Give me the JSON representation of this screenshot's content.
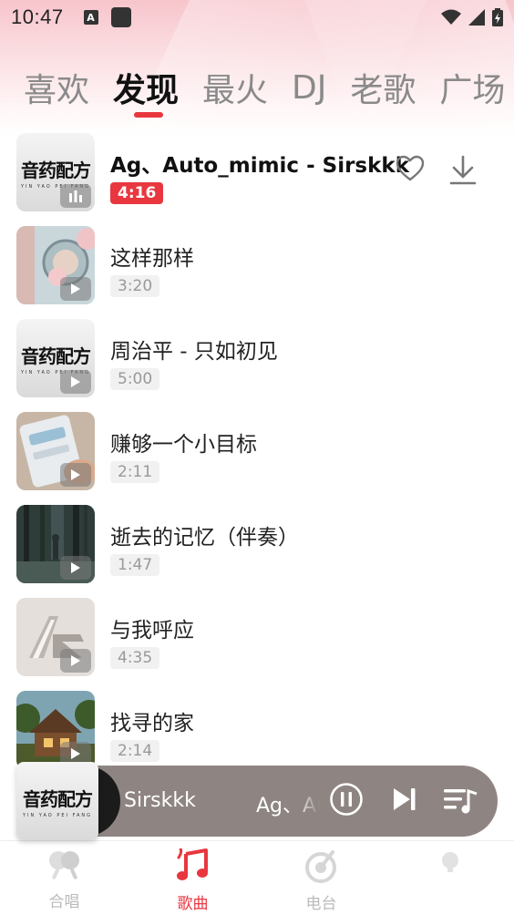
{
  "status": {
    "time": "10:47",
    "a_badge": "A"
  },
  "tabs": [
    "喜欢",
    "发现",
    "最火",
    "DJ",
    "老歌",
    "广场"
  ],
  "active_tab": "发现",
  "songs": [
    {
      "title": "Ag、Auto_mimic - Sirskkk",
      "duration": "4:16",
      "playing": true,
      "cover": "logo"
    },
    {
      "title": "这样那样",
      "duration": "3:20",
      "playing": false,
      "cover": "photo-pink"
    },
    {
      "title": "周治平 - 只如初见",
      "duration": "5:00",
      "playing": false,
      "cover": "logo"
    },
    {
      "title": "赚够一个小目标",
      "duration": "2:11",
      "playing": false,
      "cover": "photo-phone"
    },
    {
      "title": "逝去的记忆（伴奏）",
      "duration": "1:47",
      "playing": false,
      "cover": "photo-forest"
    },
    {
      "title": "与我呼应",
      "duration": "4:35",
      "playing": false,
      "cover": "photo-letters"
    },
    {
      "title": "找寻的家",
      "duration": "2:14",
      "playing": false,
      "cover": "photo-cabin"
    }
  ],
  "cover_logo": {
    "text": "音药配方",
    "sub": "YIN YAO PEI FANG"
  },
  "mini_player": {
    "title_part1": "Sirskkk",
    "title_part2": "Ag、Auto"
  },
  "bottom_nav": [
    {
      "label": "合唱",
      "icon": "chorus-icon",
      "active": false
    },
    {
      "label": "歌曲",
      "icon": "music-note-icon",
      "active": true
    },
    {
      "label": "电台",
      "icon": "radio-icon",
      "active": false
    },
    {
      "label": "",
      "icon": "bulb-icon",
      "active": false
    }
  ],
  "colors": {
    "accent": "#e8373f",
    "player_bg": "#8e8582"
  }
}
